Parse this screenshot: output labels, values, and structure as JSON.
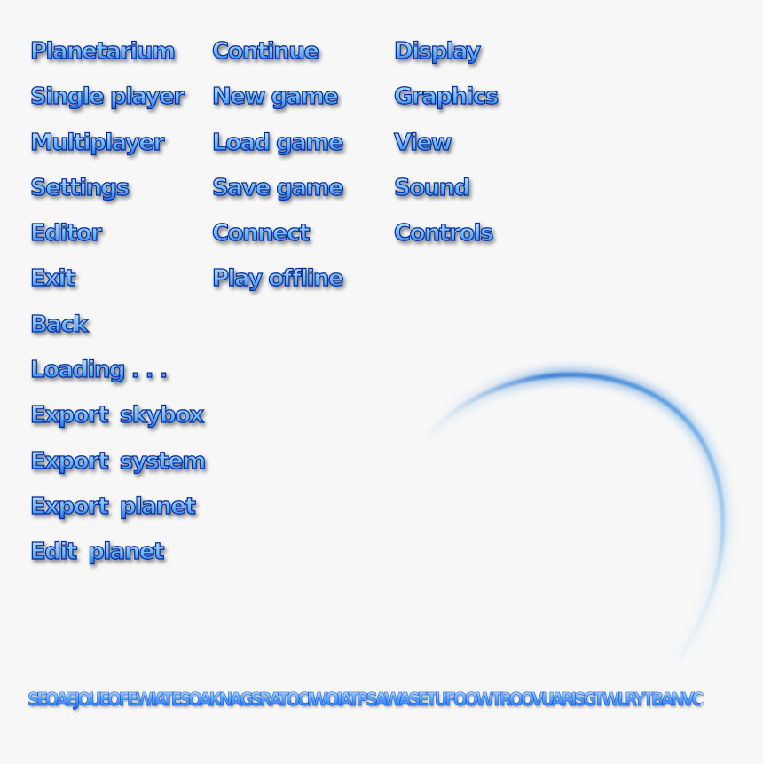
{
  "menu": {
    "column1": [
      "Planetarium",
      "Single player",
      "Multiplayer",
      "Settings",
      "Editor",
      "Exit",
      "Back",
      "Loading . . .",
      "Export  skybox",
      "Export  system",
      "Export  planet",
      "Edit  planet"
    ],
    "column2": [
      "Continue",
      "New game",
      "Load game",
      "Save game",
      "Connect",
      "Play offline"
    ],
    "column3": [
      "Display",
      "Graphics",
      "View",
      "Sound",
      "Controls"
    ]
  },
  "charset": "SEOAEJOUEOFEWIATESOAKNAGSRATOCIWOIATPSAWASETUFOOWTROOVUARISGTWLRYTBANVC",
  "colors": {
    "text_top": "#d8ecff",
    "text_mid": "#1f6ff2",
    "text_outline": "#0a2f9a",
    "arc": "#3a86d4",
    "background": "#f7f7f7"
  }
}
